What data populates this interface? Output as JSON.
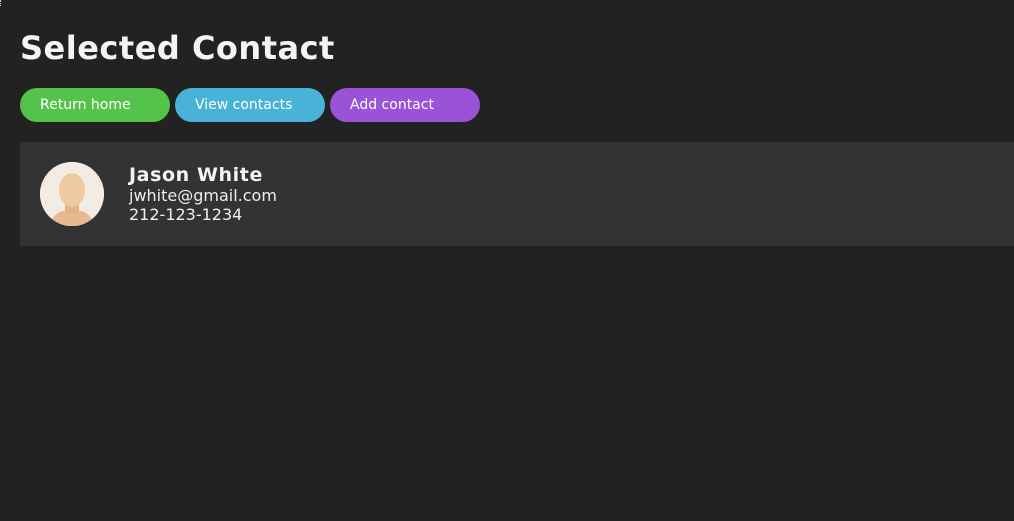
{
  "page": {
    "title": "Selected Contact"
  },
  "nav": {
    "return_home_label": "Return home",
    "view_contacts_label": "View contacts",
    "add_contact_label": "Add contact"
  },
  "contact": {
    "name": "Jason White",
    "email": "jwhite@gmail.com",
    "phone": "212-123-1234",
    "avatar_icon": "person-avatar-icon"
  },
  "colors": {
    "background": "#222222",
    "card": "#333333",
    "return_home": "#55c24c",
    "view_contacts": "#48b3d6",
    "add_contact": "#9a53d6"
  }
}
